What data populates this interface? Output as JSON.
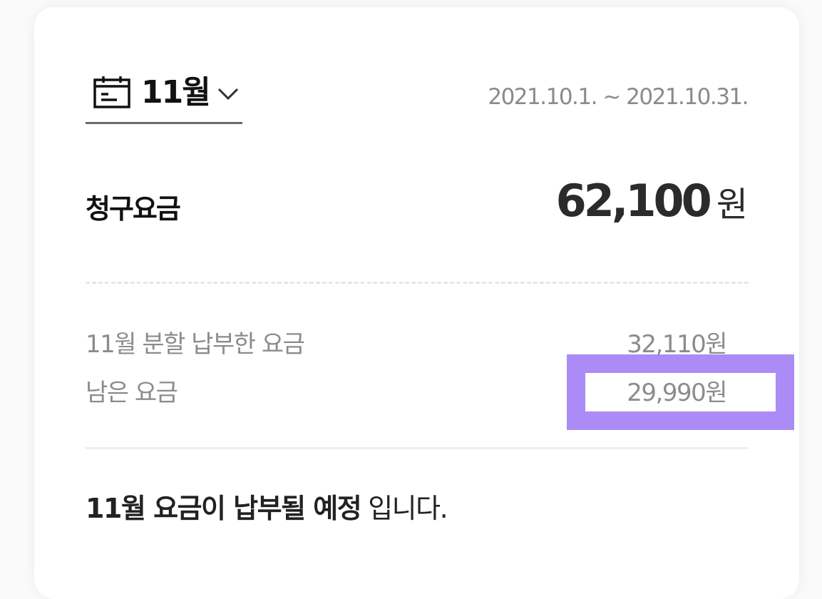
{
  "header": {
    "month_label": "11월",
    "period": "2021.10.1. ~ 2021.10.31."
  },
  "bill": {
    "label": "청구요금",
    "amount": "62,100",
    "unit": "원"
  },
  "breakdown": [
    {
      "label": "11월 분할 납부한 요금",
      "value": "32,110원"
    },
    {
      "label": "남은 요금",
      "value": "29,990원"
    }
  ],
  "notice": {
    "emphasis": "11월 요금이 납부될 예정",
    "rest": "입니다."
  },
  "colors": {
    "highlight_frame": "#ab8bf5",
    "emphasis_underline": "#f2c3c3"
  },
  "icons": {
    "calendar": "calendar-icon",
    "chevron": "chevron-down-icon"
  }
}
